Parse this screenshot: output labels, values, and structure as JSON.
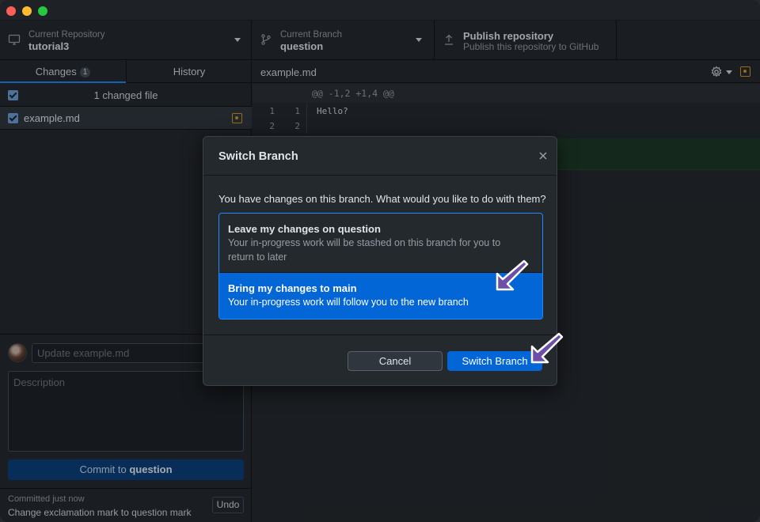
{
  "window": {
    "traffic_lights": [
      "close",
      "minimize",
      "zoom"
    ]
  },
  "toolbar": {
    "repository": {
      "label": "Current Repository",
      "value": "tutorial3",
      "icon": "desktop-icon"
    },
    "branch": {
      "label": "Current Branch",
      "value": "question",
      "icon": "branch-icon"
    },
    "publish": {
      "title": "Publish repository",
      "subtitle": "Publish this repository to GitHub",
      "icon": "upload-icon"
    }
  },
  "sidebar": {
    "tabs": [
      {
        "label": "Changes",
        "badge": "1"
      },
      {
        "label": "History"
      }
    ],
    "changed_header": "1 changed file",
    "files": [
      {
        "name": "example.md",
        "status": "modified"
      }
    ],
    "commit": {
      "summary_placeholder": "Update example.md",
      "description_placeholder": "Description",
      "button_prefix": "Commit to",
      "button_branch": "question"
    },
    "last_commit": {
      "time": "Committed just now",
      "message": "Change exclamation mark to question mark",
      "undo_label": "Undo"
    }
  },
  "diff": {
    "filename": "example.md",
    "hunk_header": "@@ -1,2 +1,4 @@",
    "lines": [
      {
        "old": "1",
        "new": "1",
        "text": "Hello?"
      },
      {
        "old": "2",
        "new": "2",
        "text": ""
      }
    ]
  },
  "modal": {
    "title": "Switch Branch",
    "question": "You have changes on this branch. What would you like to do with them?",
    "options": [
      {
        "title": "Leave my changes on question",
        "description": "Your in-progress work will be stashed on this branch for you to return to later",
        "selected": false
      },
      {
        "title": "Bring my changes to main",
        "description": "Your in-progress work will follow you to the new branch",
        "selected": true
      }
    ],
    "cancel_label": "Cancel",
    "confirm_label": "Switch Branch"
  },
  "colors": {
    "accent": "#0366d6",
    "selection_border": "#2188ff",
    "modified": "#d29922",
    "annotation_arrow": "#6e4fa8"
  }
}
